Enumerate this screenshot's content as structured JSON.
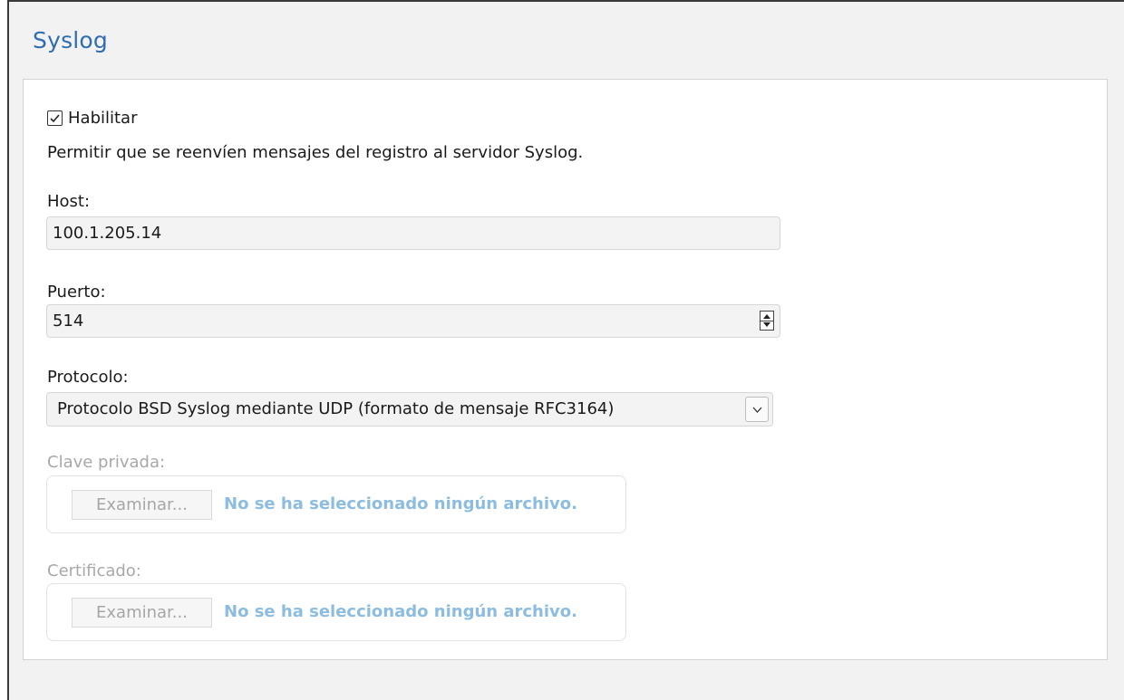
{
  "section": {
    "title": "Syslog"
  },
  "enable": {
    "label": "Habilitar",
    "checked": true,
    "description": "Permitir que se reenvíen mensajes del registro al servidor Syslog."
  },
  "host": {
    "label": "Host:",
    "value": "100.1.205.14"
  },
  "port": {
    "label": "Puerto:",
    "value": "514"
  },
  "protocol": {
    "label": "Protocolo:",
    "selected": "Protocolo BSD Syslog mediante UDP (formato de mensaje RFC3164)"
  },
  "private_key": {
    "label": "Clave privada:",
    "browse_label": "Examinar...",
    "status": "No se ha seleccionado ningún archivo."
  },
  "certificate": {
    "label": "Certificado:",
    "browse_label": "Examinar...",
    "status": "No se ha seleccionado ningún archivo."
  },
  "colors": {
    "title": "#2f6db0",
    "disabled_text": "#a8a8a8",
    "no_file_text": "#8cbde0"
  }
}
